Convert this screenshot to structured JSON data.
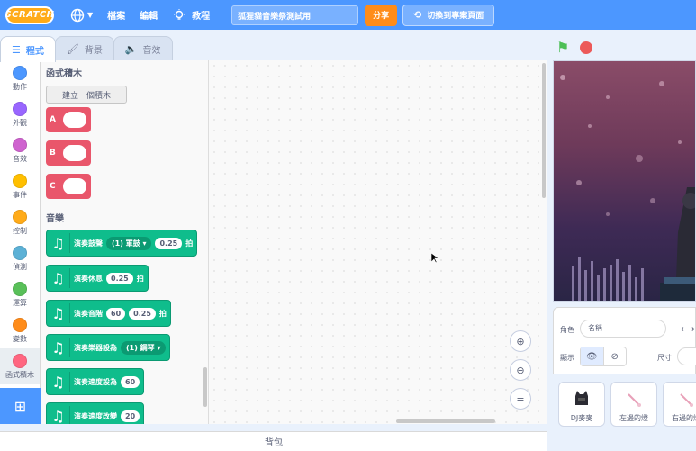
{
  "menubar": {
    "logo": "SCRATCH",
    "file": "檔案",
    "edit": "編輯",
    "tutorials": "教程",
    "project_title": "狐狸貓音樂祭測試用",
    "share": "分享",
    "see_project_page": "切換到專案頁面"
  },
  "tabs": [
    {
      "label": "程式",
      "icon": "code-icon"
    },
    {
      "label": "背景",
      "icon": "brush-icon"
    },
    {
      "label": "音效",
      "icon": "speaker-icon"
    }
  ],
  "categories": [
    {
      "label": "動作",
      "color": "#4c97ff"
    },
    {
      "label": "外觀",
      "color": "#9966ff"
    },
    {
      "label": "音效",
      "color": "#cf63cf"
    },
    {
      "label": "事件",
      "color": "#ffbf00"
    },
    {
      "label": "控制",
      "color": "#ffab19"
    },
    {
      "label": "偵測",
      "color": "#5cb1d6"
    },
    {
      "label": "運算",
      "color": "#59c059"
    },
    {
      "label": "變數",
      "color": "#ff8c1a"
    },
    {
      "label": "函式積木",
      "color": "#ff6680"
    },
    {
      "label": "音樂",
      "color": "music"
    }
  ],
  "palette": {
    "my_blocks_heading": "函式積木",
    "make_block": "建立一個積木",
    "custom_blocks": [
      "A",
      "B",
      "C"
    ],
    "music_heading": "音樂",
    "music_blocks": [
      {
        "text": "演奏鼓聲",
        "dropdown": "(1) 軍鼓 ▾",
        "value": "0.25",
        "suffix": "拍"
      },
      {
        "text": "演奏休息",
        "value": "0.25",
        "suffix": "拍"
      },
      {
        "text": "演奏音階",
        "value": "60",
        "value2": "0.25",
        "suffix": "拍"
      },
      {
        "text": "演奏樂器設為",
        "dropdown": "(1) 鋼琴 ▾"
      },
      {
        "text": "演奏速度設為",
        "value": "60"
      },
      {
        "text": "演奏速度改變",
        "value": "20"
      }
    ]
  },
  "backpack": "背包",
  "sprite_info": {
    "sprite_label": "角色",
    "sprite_name_placeholder": "名稱",
    "show_label": "顯示",
    "size_label": "尺寸"
  },
  "sprites": [
    {
      "name": "DJ麥麥"
    },
    {
      "name": "左邊的燈"
    },
    {
      "name": "右邊的燈"
    }
  ],
  "colors": {
    "menubar": "#4c97ff",
    "share": "#ff8c1a",
    "my_blocks": "#e9566b",
    "music": "#0fbd8c"
  }
}
